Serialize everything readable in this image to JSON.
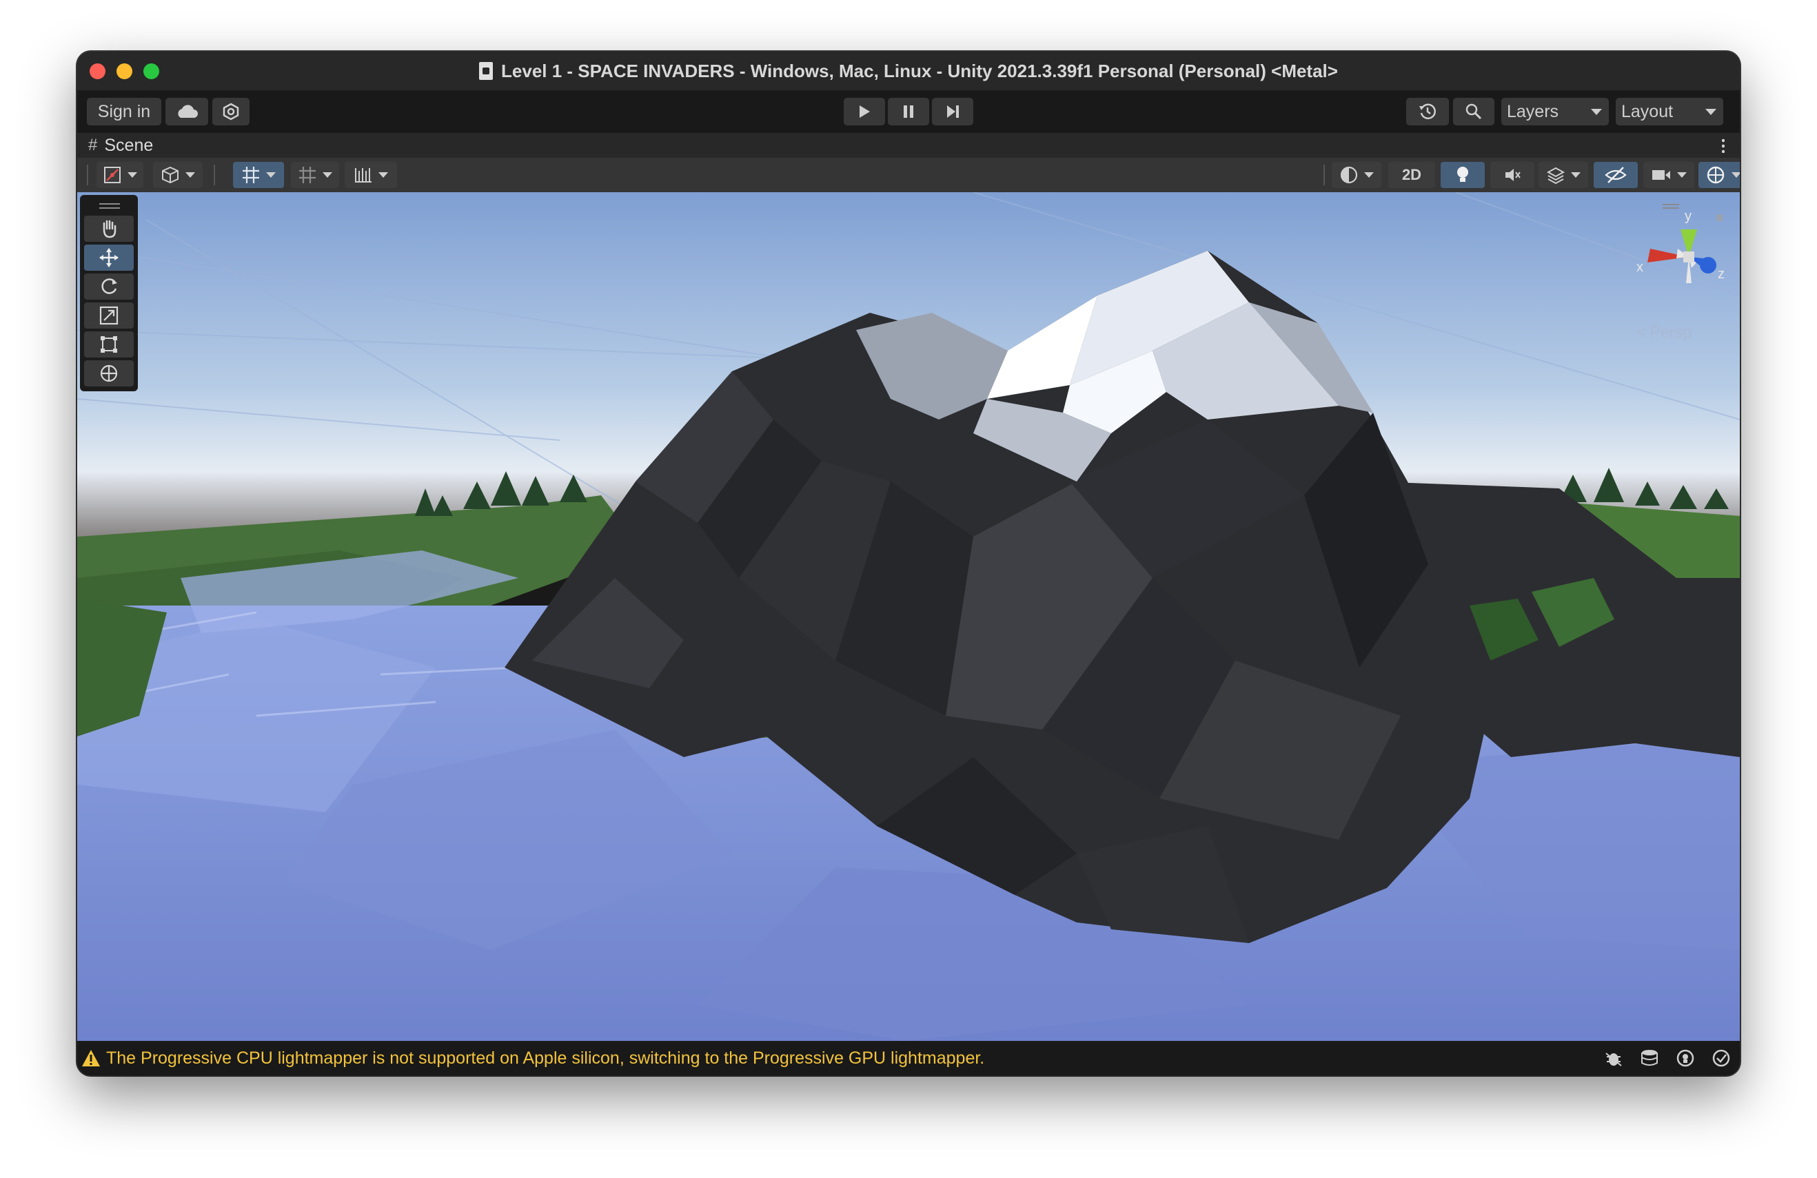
{
  "window": {
    "title": "Level 1 - SPACE INVADERS - Windows, Mac, Linux - Unity 2021.3.39f1 Personal (Personal) <Metal>"
  },
  "toolbar": {
    "sign_in_label": "Sign in",
    "cloud_icon": "cloud-icon",
    "settings_icon": "services-icon",
    "play_icon": "play-icon",
    "pause_icon": "pause-icon",
    "step_icon": "step-icon",
    "history_icon": "undo-history-icon",
    "search_icon": "search-icon",
    "layers_label": "Layers",
    "layout_label": "Layout"
  },
  "scene_tab": {
    "label": "Scene"
  },
  "scene_toolbar": {
    "toggle_2d_label": "2D"
  },
  "tools": [
    "hand-tool",
    "move-tool",
    "rotate-tool",
    "scale-tool",
    "rect-tool",
    "transform-tool"
  ],
  "gizmo": {
    "x_label": "x",
    "y_label": "y",
    "z_label": "z",
    "projection_label": "Persp"
  },
  "status": {
    "message": "The Progressive CPU lightmapper is not supported on Apple silicon, switching to the Progressive GPU lightmapper."
  },
  "colors": {
    "accent_selected": "#46607c",
    "warning_text": "#f3c33b",
    "water": "#7f90d6",
    "rock": "#2c2d31",
    "snow": "#d8dde8",
    "grass": "#3f6a34"
  }
}
